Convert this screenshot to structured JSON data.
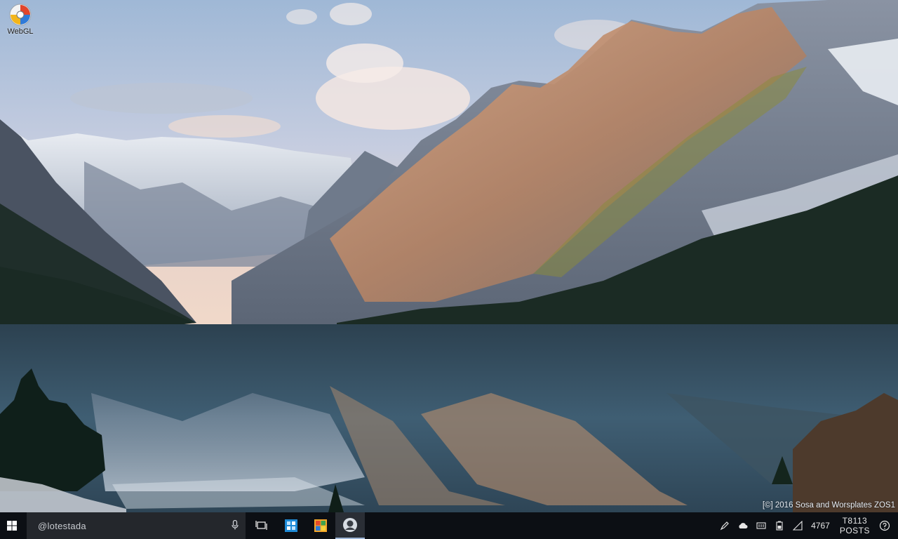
{
  "desktop": {
    "icons": [
      {
        "label": "WebGL",
        "icon": "webgl-app-icon"
      }
    ],
    "watermark": "[©] 2016 Sosa and Worsplates ZOS1"
  },
  "taskbar": {
    "start_icon": "windows-start-icon",
    "search": {
      "text": "@lotestada",
      "icon": "mic-icon"
    },
    "apps": [
      {
        "name": "task-view",
        "icon": "task-view-icon"
      },
      {
        "name": "store",
        "icon": "store-icon"
      },
      {
        "name": "windows-app",
        "icon": "windows-logo-icon"
      },
      {
        "name": "app-active",
        "icon": "circle-app-icon",
        "active": true
      }
    ],
    "tray": {
      "icons": [
        "pen-icon",
        "cloud-icon",
        "keyboard-icon",
        "battery-icon",
        "network-icon",
        "help-icon"
      ],
      "status_text": "4767",
      "clock_time": "T8113",
      "clock_date": "POSTS"
    }
  },
  "colors": {
    "taskbar_bg": "#0c0f14",
    "search_bg": "#24272c",
    "active_accent": "#9fb7d8"
  }
}
